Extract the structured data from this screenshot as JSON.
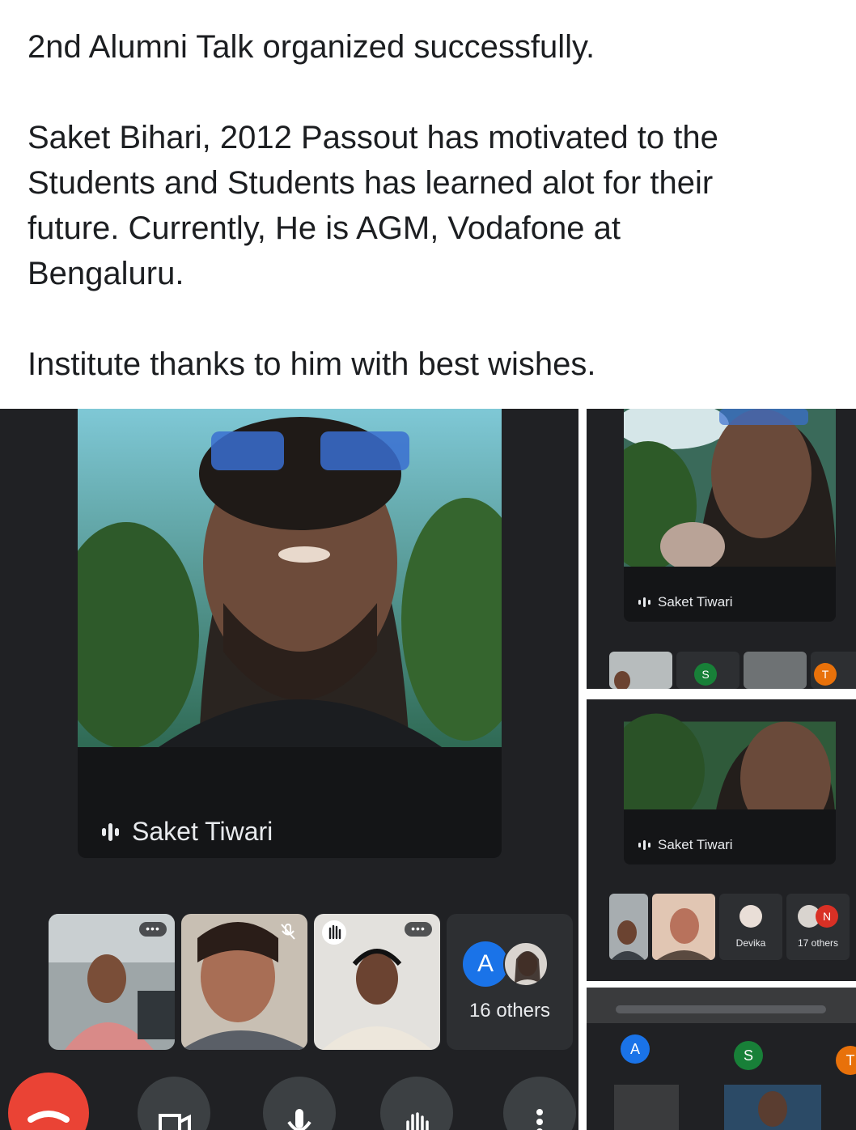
{
  "post": {
    "line1": "2nd Alumni Talk organized successfully.",
    "para2_l1": "Saket Bihari, 2012 Passout has motivated to the",
    "para2_l2": "Students and Students has learned alot for their",
    "para2_l3": "future. Currently, He is AGM, Vodafone at",
    "para2_l4": "Bengaluru.",
    "line3": "Institute thanks to him with best wishes."
  },
  "main_call": {
    "speaker_name": "Saket Tiwari",
    "others_avatar_letter": "A",
    "others_count_label": "16 others",
    "controls": [
      "hang-up",
      "camera",
      "microphone",
      "raise-hand",
      "more-options"
    ]
  },
  "right_top": {
    "speaker_name": "Saket Tiwari",
    "tile_letters": [
      "S",
      "T"
    ]
  },
  "right_mid": {
    "speaker_name": "Saket Tiwari",
    "tile_name_devika": "Devika",
    "others_letter": "N",
    "others_count_label": "17 others"
  },
  "right_bot": {
    "avatar_letters": [
      "A",
      "S",
      "T"
    ]
  },
  "colors": {
    "call_bg": "#202124",
    "name_bar": "#141517",
    "hangup": "#ea4335",
    "avatar_blue": "#1a73e8",
    "avatar_green": "#188038",
    "avatar_orange": "#e8710a",
    "avatar_red": "#d93025"
  }
}
